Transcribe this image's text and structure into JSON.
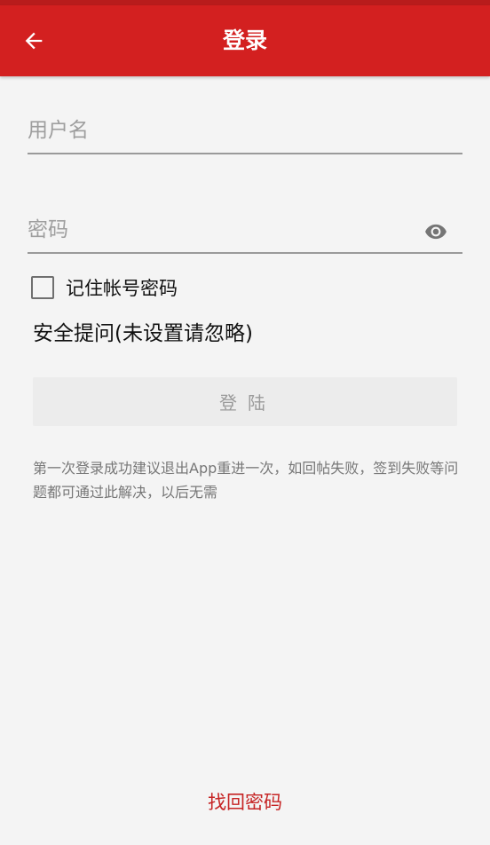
{
  "app_bar": {
    "title": "登录",
    "back_icon": "arrow-left-icon",
    "color": "#d32020"
  },
  "username": {
    "placeholder": "用户名",
    "value": ""
  },
  "password": {
    "placeholder": "密码",
    "value": "",
    "toggle_icon": "eye-icon"
  },
  "remember": {
    "label": "记住帐号密码",
    "checked": false
  },
  "security_question": {
    "label": "安全提问(未设置请忽略)"
  },
  "login_button": {
    "label": "登陆"
  },
  "hint": {
    "text": "第一次登录成功建议退出App重进一次，如回帖失败，签到失败等问题都可通过此解决，以后无需"
  },
  "forgot_password": {
    "label": "找回密码",
    "color": "#c62424"
  }
}
